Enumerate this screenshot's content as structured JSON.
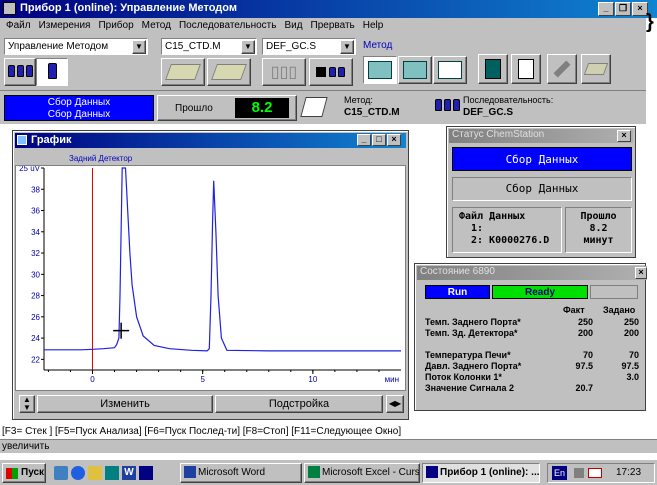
{
  "app": {
    "title": "Прибор 1 (online): Управление Методом",
    "menu": [
      "Файл",
      "Измерения",
      "Прибор",
      "Метод",
      "Последовательность",
      "Вид",
      "Прервать",
      "Help"
    ]
  },
  "toolbar": {
    "view_select": "Управление Методом",
    "method_select": "C15_CTD.M",
    "sequence_select": "DEF_GC.S",
    "method_label": "Метод"
  },
  "status_row": {
    "status_line1": "Сбор Данных",
    "status_line2": "Сбор  Данных",
    "elapsed_label": "Прошло",
    "elapsed_value": "8.2",
    "method_caption": "Метод:",
    "method_value": "C15_CTD.M",
    "sequence_caption": "Последовательность:",
    "sequence_value": "DEF_GC.S"
  },
  "graph_window": {
    "title": "График",
    "signal_label": "Задний Детектор",
    "modify_button": "Изменить",
    "adjust_button": "Подстройка"
  },
  "chart_data": {
    "type": "line",
    "xlabel": "мин",
    "ylabel": "uV",
    "x_ticks": [
      "0",
      "5",
      "10"
    ],
    "y_ticks": [
      "22",
      "24",
      "26",
      "28",
      "30",
      "32",
      "34",
      "36",
      "38",
      "25 uV"
    ],
    "xlim": [
      -2.2,
      14.0
    ],
    "ylim": [
      21.0,
      40.0
    ],
    "run_start_marker_x": 0,
    "series": [
      {
        "values": [
          [
            -2.2,
            22.9
          ],
          [
            -0.5,
            22.9
          ],
          [
            0,
            22.95
          ],
          [
            0.5,
            23.0
          ],
          [
            1.0,
            23.1
          ],
          [
            1.1,
            23.4
          ],
          [
            1.2,
            24.0
          ],
          [
            1.25,
            28.0
          ],
          [
            1.3,
            34.0
          ],
          [
            1.35,
            40.0
          ],
          [
            1.5,
            40.0
          ],
          [
            1.6,
            36.0
          ],
          [
            1.7,
            32.0
          ],
          [
            1.8,
            29.0
          ],
          [
            2.0,
            26.0
          ],
          [
            2.3,
            24.2
          ],
          [
            2.8,
            23.3
          ],
          [
            3.5,
            23.0
          ],
          [
            4.5,
            22.85
          ],
          [
            5.2,
            22.8
          ],
          [
            5.3,
            23.0
          ],
          [
            5.38,
            28.0
          ],
          [
            5.45,
            35.0
          ],
          [
            5.5,
            38.8
          ],
          [
            5.6,
            34.0
          ],
          [
            5.7,
            28.0
          ],
          [
            5.85,
            24.0
          ],
          [
            6.1,
            22.85
          ],
          [
            8.0,
            22.8
          ],
          [
            14.0,
            22.8
          ]
        ]
      }
    ]
  },
  "chem_status": {
    "title": "Статус ChemStation",
    "status_active": "Сбор Данных",
    "status_line": "Сбор   Данных",
    "file_label": "Файл Данных",
    "file_line1": "1:",
    "file_line2": "2: K0000276.D",
    "elapsed_label": "Прошло",
    "elapsed_value": "8.2",
    "elapsed_unit": "минут"
  },
  "gc_status": {
    "title": "Состояние 6890",
    "run_label": "Run",
    "ready_label": "Ready",
    "col_actual": "Факт",
    "col_setpoint": "Задано",
    "rows": [
      {
        "name": "Темп. Заднего Порта*",
        "actual": "250",
        "setpoint": "250"
      },
      {
        "name": "Темп. Зд. Детектора*",
        "actual": "200",
        "setpoint": "200"
      },
      {
        "name": "",
        "actual": "",
        "setpoint": ""
      },
      {
        "name": "Температура Печи*",
        "actual": "70",
        "setpoint": "70"
      },
      {
        "name": "Давл. Заднего Порта*",
        "actual": "97.5",
        "setpoint": "97.5"
      },
      {
        "name": "Поток Колонки 1*",
        "actual": "",
        "setpoint": "3.0"
      },
      {
        "name": "Значение Сигнала 2",
        "actual": "20.7",
        "setpoint": ""
      }
    ]
  },
  "hotkeys": "[F3= Стек ] [F5=Пуск Анализа] [F6=Пуск Послед-ти] [F8=Стоп] [F11=Следующее Окно]",
  "statusbar": "увеличить",
  "taskbar": {
    "start": "Пуск",
    "tasks": [
      "Microsoft Word",
      "Microsoft Excel - Curs_0...",
      "Прибор 1 (online): ..."
    ],
    "lang": "En",
    "clock": "17:23"
  },
  "colors": {
    "status_blue": "#0000ff",
    "elapsed_green": "#00ff00",
    "trace_blue": "#2020e0",
    "marker_red": "#e00000",
    "ready_green": "#00e000"
  }
}
